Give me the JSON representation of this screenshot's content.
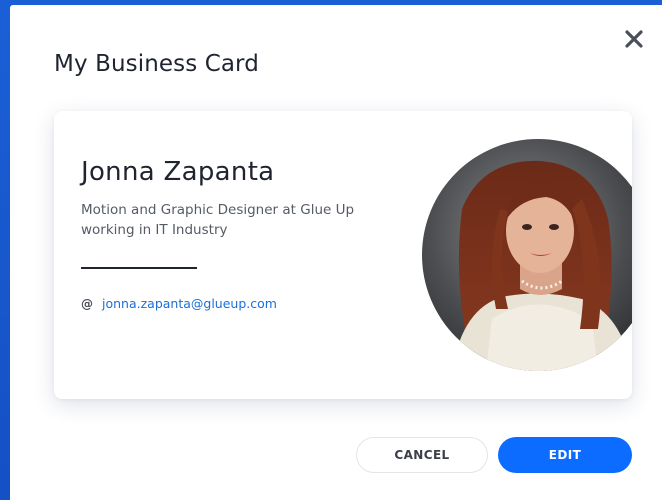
{
  "modal": {
    "title": "My Business Card",
    "close_icon": "close-icon"
  },
  "card": {
    "name": "Jonna Zapanta",
    "description": "Motion and Graphic Designer at Glue Up working in IT Industry",
    "email_icon": "at-icon",
    "email_symbol": "@",
    "email": "jonna.zapanta@glueup.com"
  },
  "actions": {
    "cancel_label": "CANCEL",
    "edit_label": "EDIT"
  },
  "colors": {
    "backdrop": "#1554c8",
    "primary": "#0b6cff",
    "link": "#1a6fd8",
    "text": "#1f2430"
  }
}
